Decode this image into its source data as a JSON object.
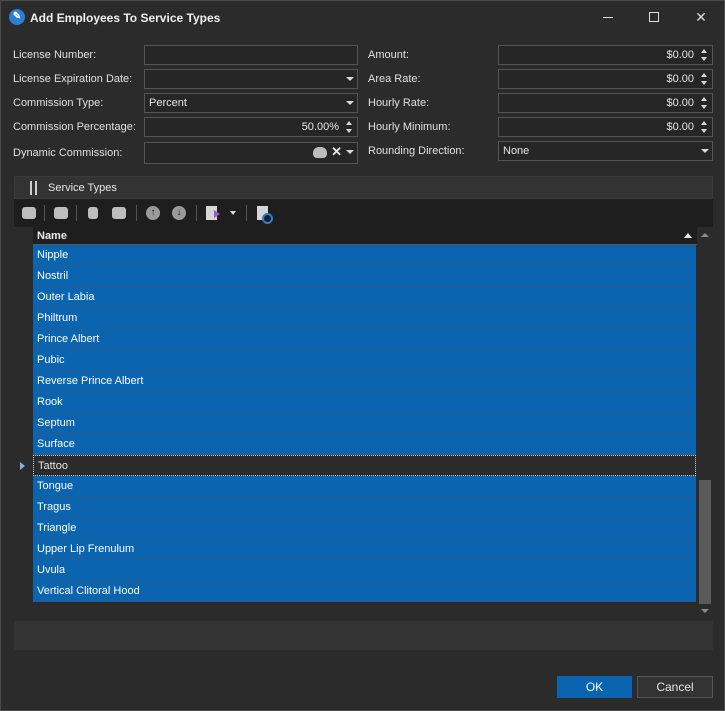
{
  "window": {
    "title": "Add Employees To Service Types",
    "app_icon": "wrench-icon",
    "controls": [
      "minimize",
      "maximize",
      "close"
    ]
  },
  "form": {
    "license_number": {
      "label": "License Number:",
      "value": ""
    },
    "license_expiration": {
      "label": "License Expiration Date:",
      "value": ""
    },
    "commission_type": {
      "label": "Commission Type:",
      "value": "Percent"
    },
    "commission_percentage": {
      "label": "Commission Percentage:",
      "value": "50.00%"
    },
    "dynamic_commission": {
      "label": "Dynamic Commission:",
      "value": ""
    },
    "amount": {
      "label": "Amount:",
      "value": "$0.00"
    },
    "area_rate": {
      "label": "Area Rate:",
      "value": "$0.00"
    },
    "hourly_rate": {
      "label": "Hourly Rate:",
      "value": "$0.00"
    },
    "hourly_minimum": {
      "label": "Hourly Minimum:",
      "value": "$0.00"
    },
    "rounding_direction": {
      "label": "Rounding Direction:",
      "value": "None"
    }
  },
  "service_types": {
    "title": "Service Types",
    "column_name": "Name",
    "rows": [
      "Nipple",
      "Nostril",
      "Outer Labia",
      "Philtrum",
      "Prince Albert",
      "Pubic",
      "Reverse Prince Albert",
      "Rook",
      "Septum",
      "Surface",
      "Tattoo",
      "Tongue",
      "Tragus",
      "Triangle",
      "Upper Lip Frenulum",
      "Uvula",
      "Vertical Clitoral Hood"
    ],
    "focused_row": "Tattoo",
    "selection_color": "#0a64b0"
  },
  "buttons": {
    "ok": "OK",
    "cancel": "Cancel"
  }
}
